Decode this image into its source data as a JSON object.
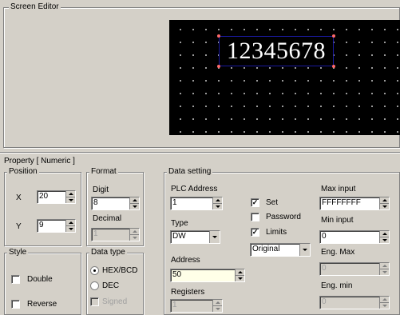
{
  "editor": {
    "title": "Screen Editor",
    "display_value": "12345678"
  },
  "property": {
    "title": "Property [ Numeric ]"
  },
  "position": {
    "title": "Position",
    "x_label": "X",
    "x_value": "20",
    "y_label": "Y",
    "y_value": "9"
  },
  "format": {
    "title": "Format",
    "digit_label": "Digit",
    "digit_value": "8",
    "decimal_label": "Decimal",
    "decimal_value": "1"
  },
  "style": {
    "title": "Style",
    "double_label": "Double",
    "reverse_label": "Reverse"
  },
  "data_type": {
    "title": "Data type",
    "hex_label": "HEX/BCD",
    "dec_label": "DEC",
    "signed_label": "Signed"
  },
  "data_setting": {
    "title": "Data setting",
    "plc_label": "PLC Address",
    "plc_value": "1",
    "type_label": "Type",
    "type_value": "DW",
    "address_label": "Address",
    "address_value": "50",
    "registers_label": "Registers",
    "registers_value": "1",
    "set_label": "Set",
    "password_label": "Password",
    "limits_label": "Limits",
    "mode_value": "Original",
    "max_label": "Max input",
    "max_value": "FFFFFFFF",
    "min_label": "Min input",
    "min_value": "0",
    "engmax_label": "Eng. Max",
    "engmax_value": "0",
    "engmin_label": "Eng. min",
    "engmin_value": "0"
  },
  "colors": {
    "background": "#d4d0c8",
    "screen": "#000000",
    "handle": "#ff6a6a"
  }
}
